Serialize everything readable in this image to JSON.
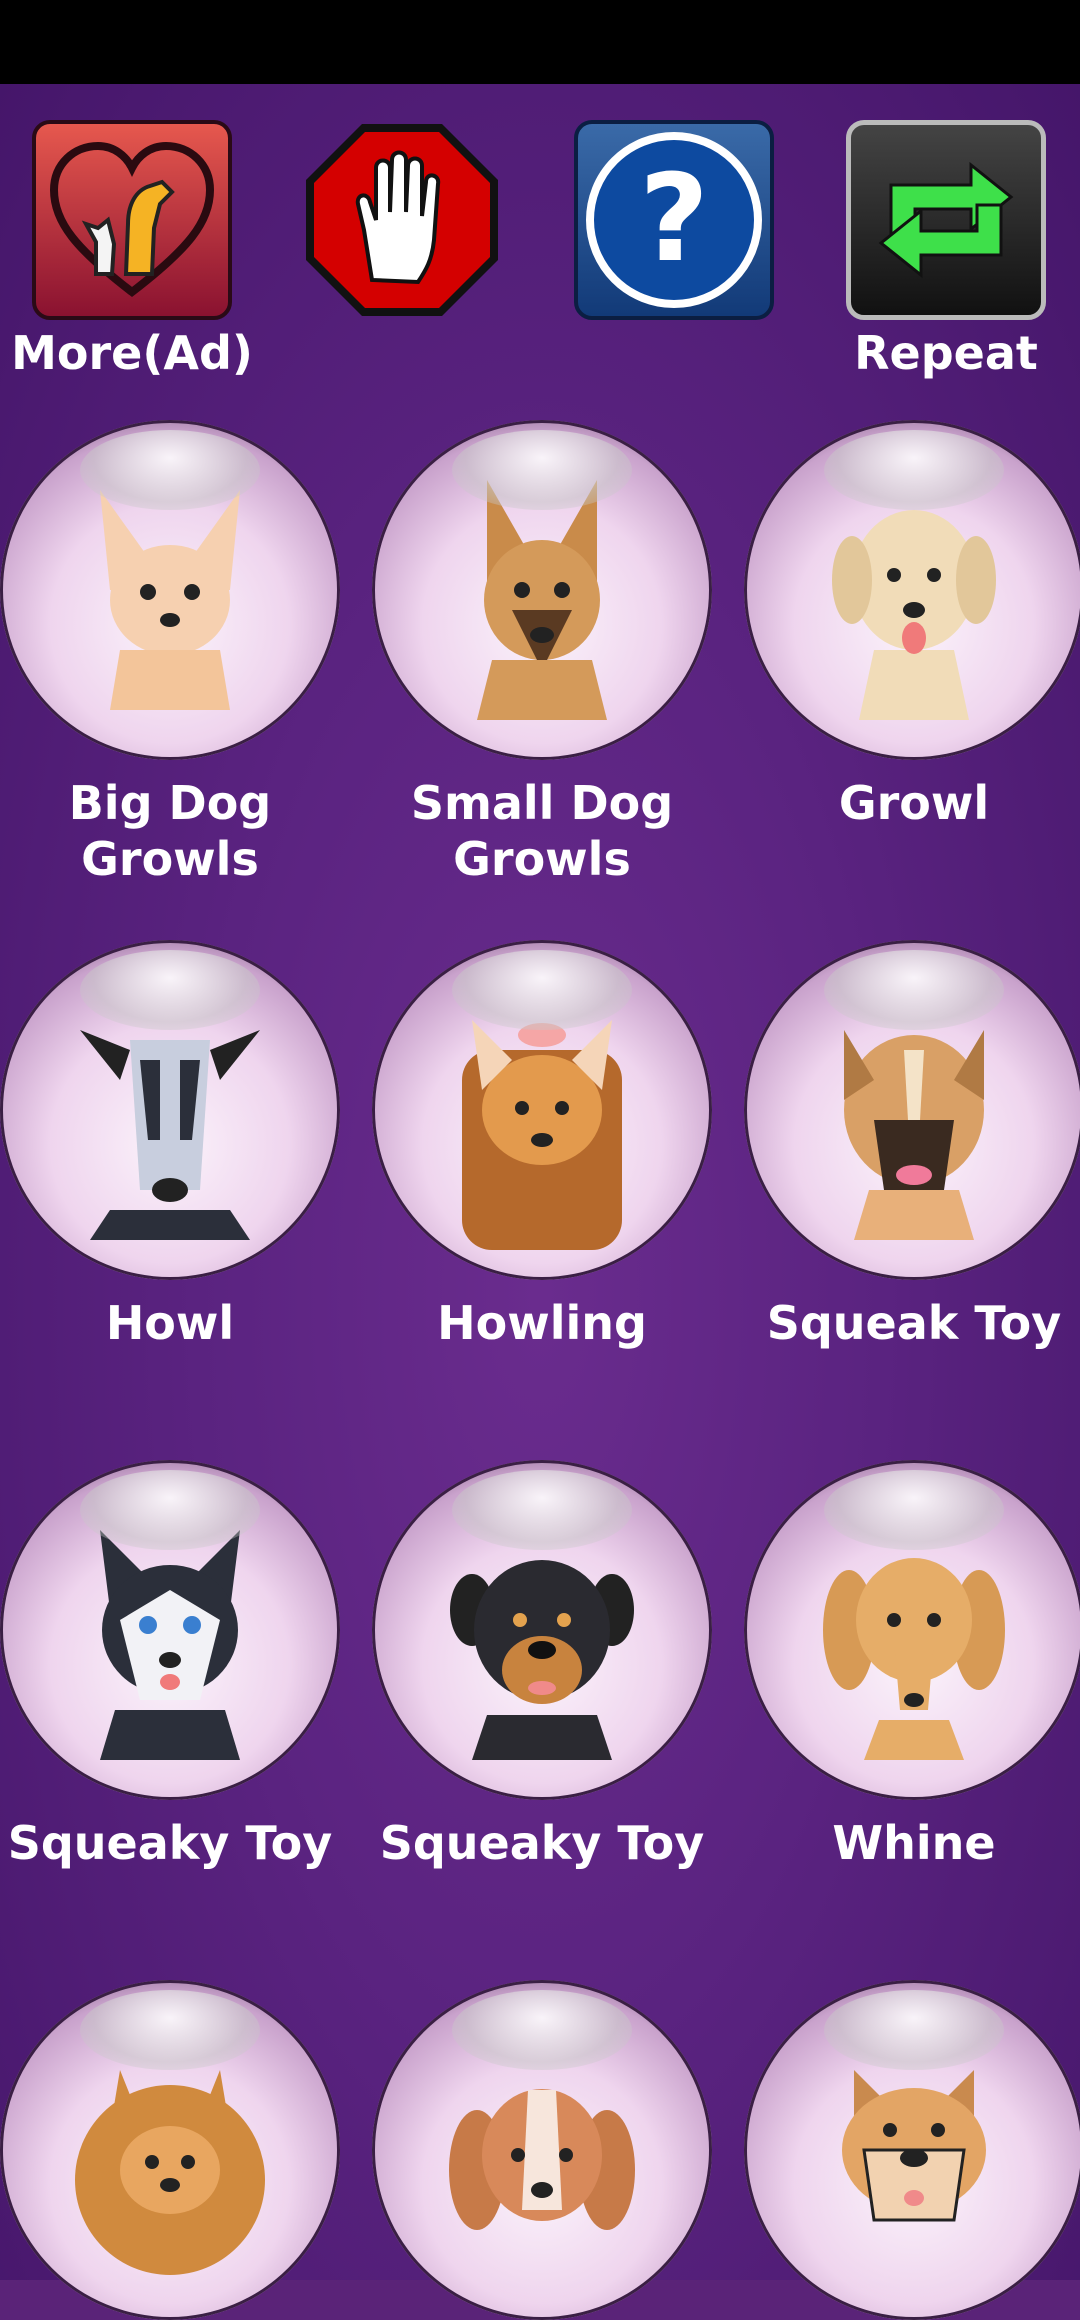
{
  "toolbar": {
    "more_label": "More(Ad)",
    "repeat_label": "Repeat"
  },
  "grid": {
    "items": [
      {
        "label": "Big Dog Growls",
        "icon": "chihuahua-icon"
      },
      {
        "label": "Small Dog Growls",
        "icon": "german-shepherd-icon"
      },
      {
        "label": "Growl",
        "icon": "labrador-icon"
      },
      {
        "label": "Howl",
        "icon": "greyhound-icon"
      },
      {
        "label": "Howling",
        "icon": "yorkshire-terrier-icon"
      },
      {
        "label": "Squeak Toy",
        "icon": "boxer-icon"
      },
      {
        "label": "Squeaky Toy",
        "icon": "husky-icon"
      },
      {
        "label": "Squeaky Toy",
        "icon": "rottweiler-icon"
      },
      {
        "label": "Whine",
        "icon": "dachshund-icon"
      },
      {
        "label": "",
        "icon": "pomeranian-icon"
      },
      {
        "label": "",
        "icon": "beagle-icon"
      },
      {
        "label": "",
        "icon": "bulldog-icon"
      }
    ]
  },
  "colors": {
    "background": "#5a2378",
    "more_button": "#c93a46",
    "stop_button": "#d40000",
    "help_button": "#1f4f94",
    "repeat_arrows": "#3ee04a"
  }
}
